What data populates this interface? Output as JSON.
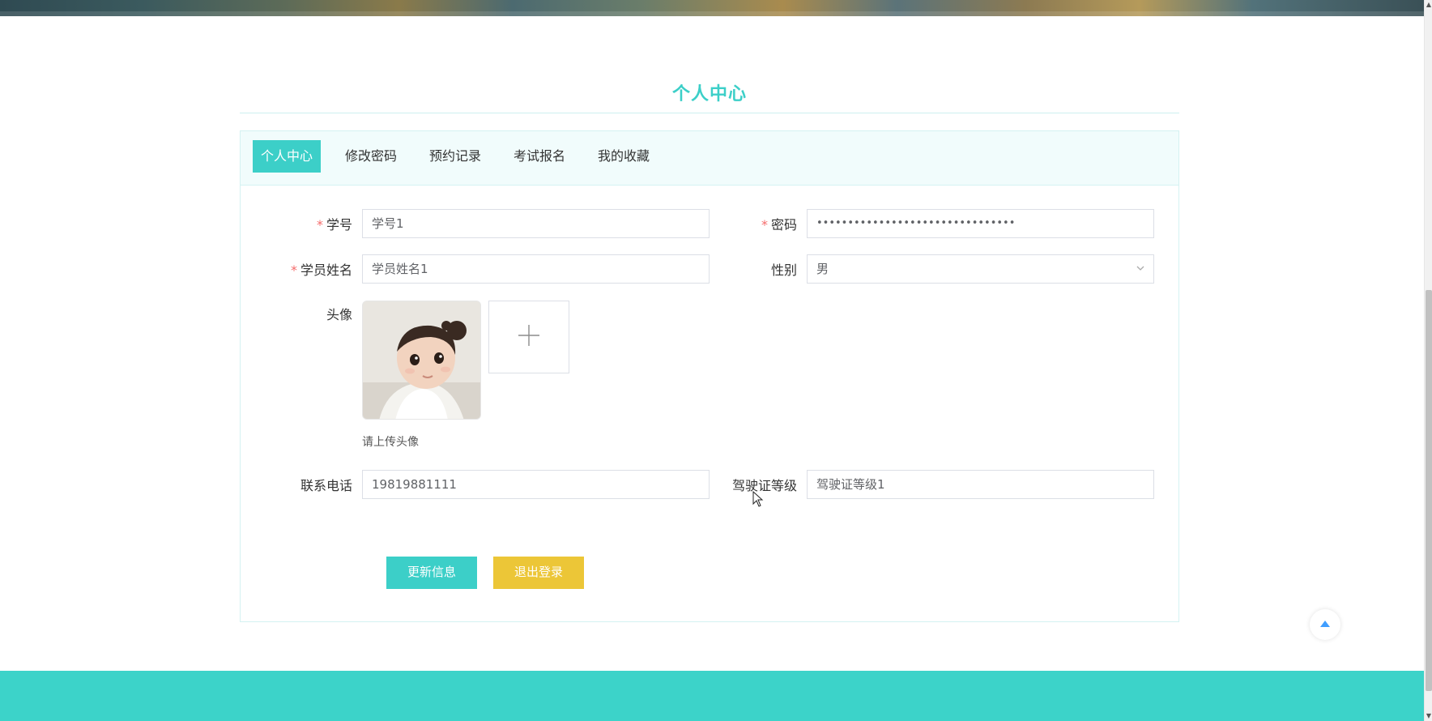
{
  "page": {
    "title": "个人中心"
  },
  "tabs": [
    {
      "label": "个人中心",
      "active": true
    },
    {
      "label": "修改密码"
    },
    {
      "label": "预约记录"
    },
    {
      "label": "考试报名"
    },
    {
      "label": "我的收藏"
    }
  ],
  "form": {
    "student_id": {
      "label": "学号",
      "required": true,
      "value": "学号1"
    },
    "password": {
      "label": "密码",
      "required": true,
      "value": "••••••••••••••••••••••••••••••••"
    },
    "student_name": {
      "label": "学员姓名",
      "required": true,
      "value": "学员姓名1"
    },
    "gender": {
      "label": "性别",
      "value": "男"
    },
    "avatar": {
      "label": "头像",
      "hint": "请上传头像"
    },
    "phone": {
      "label": "联系电话",
      "value": "19819881111"
    },
    "license_level": {
      "label": "驾驶证等级",
      "value": "驾驶证等级1"
    }
  },
  "buttons": {
    "update": "更新信息",
    "logout": "退出登录"
  },
  "icons": {
    "upload": "plus-icon",
    "back_to_top": "caret-up-icon",
    "select": "chevron-down-icon"
  },
  "colors": {
    "accent": "#3ccfc8",
    "logout": "#ecc637",
    "required": "#f56c6c",
    "footer": "#3cd3c9"
  }
}
